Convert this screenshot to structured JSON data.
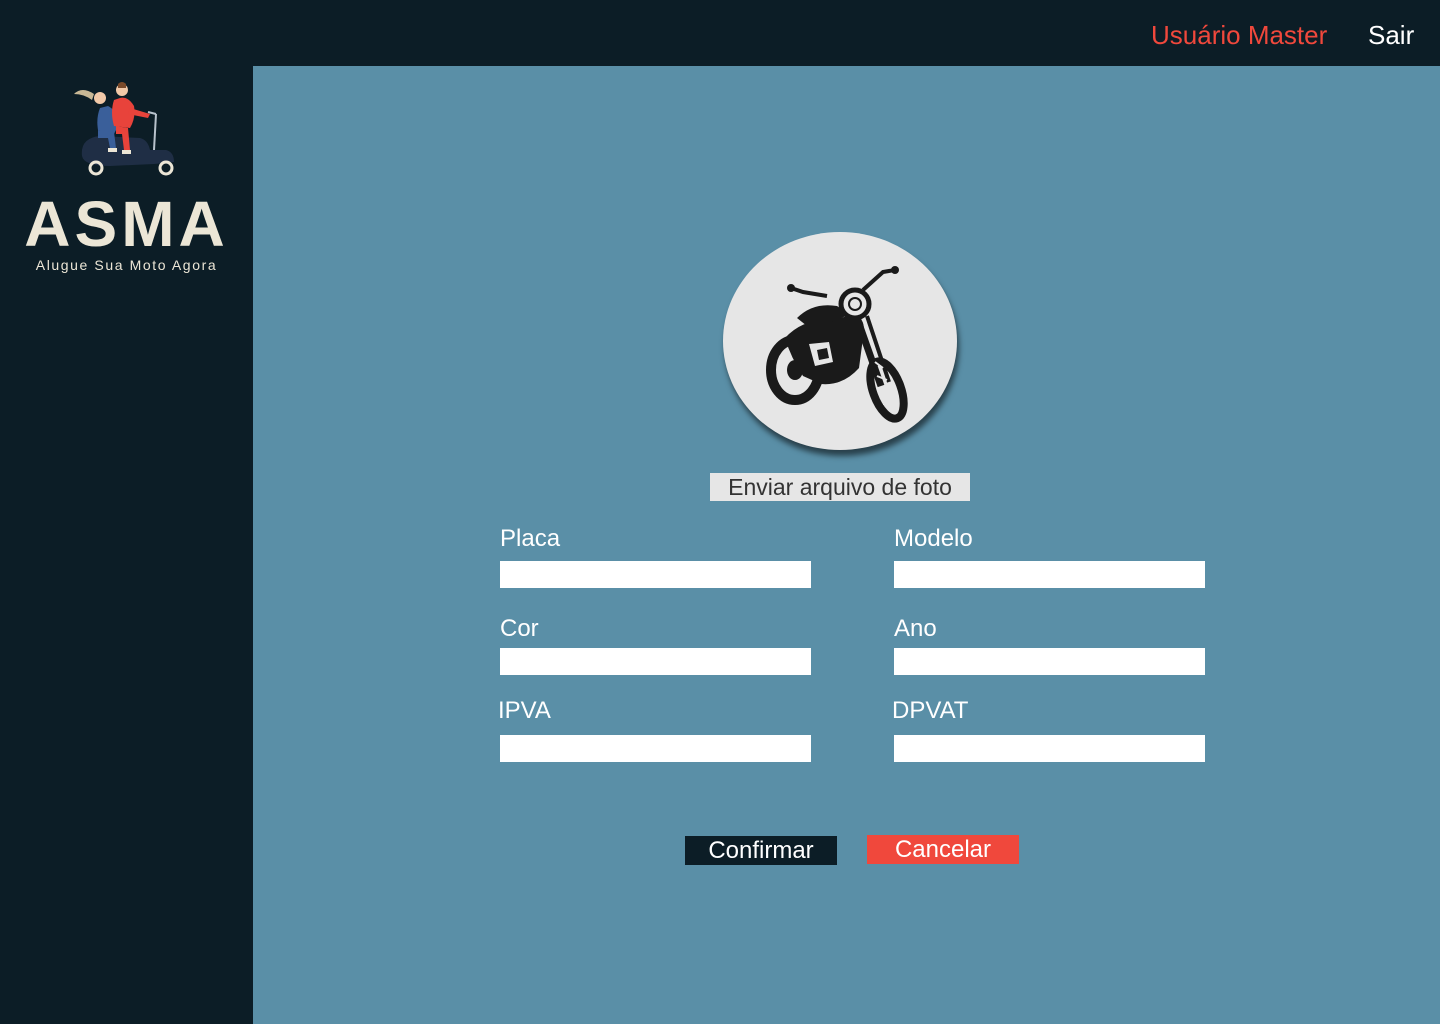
{
  "header": {
    "user_label": "Usuário Master",
    "logout_label": "Sair"
  },
  "brand": {
    "name": "ASMA",
    "tagline": "Alugue Sua Moto Agora"
  },
  "photo": {
    "icon": "motorcycle-icon",
    "upload_label": "Enviar arquivo de foto"
  },
  "form": {
    "placa": {
      "label": "Placa",
      "value": ""
    },
    "modelo": {
      "label": "Modelo",
      "value": ""
    },
    "cor": {
      "label": "Cor",
      "value": ""
    },
    "ano": {
      "label": "Ano",
      "value": ""
    },
    "ipva": {
      "label": "IPVA",
      "value": ""
    },
    "dpvat": {
      "label": "DPVAT",
      "value": ""
    }
  },
  "actions": {
    "confirm_label": "Confirmar",
    "cancel_label": "Cancelar"
  },
  "colors": {
    "dark": "#0c1d26",
    "panel": "#5a8fa7",
    "accent": "#f0483c",
    "brand_text": "#ece6d6"
  }
}
